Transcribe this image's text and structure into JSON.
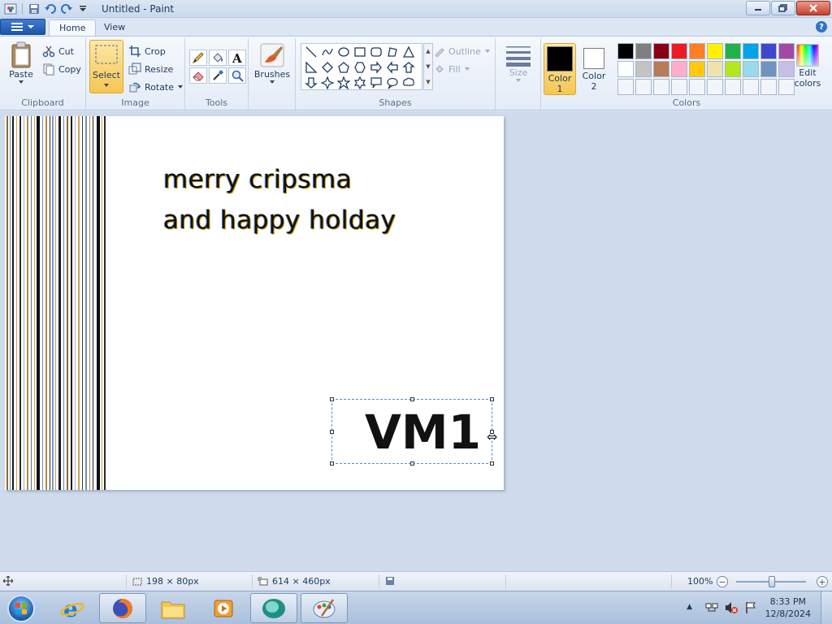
{
  "window": {
    "title": "Untitled - Paint"
  },
  "tabs": [
    {
      "label": "Home"
    },
    {
      "label": "View"
    }
  ],
  "ribbon": {
    "clipboard": {
      "group_label": "Clipboard",
      "paste_label": "Paste",
      "cut_label": "Cut",
      "copy_label": "Copy"
    },
    "image": {
      "group_label": "Image",
      "select_label": "Select",
      "crop_label": "Crop",
      "resize_label": "Resize",
      "rotate_label": "Rotate"
    },
    "tools": {
      "group_label": "Tools"
    },
    "brushes": {
      "label": "Brushes"
    },
    "shapes": {
      "group_label": "Shapes",
      "outline_label": "Outline",
      "fill_label": "Fill"
    },
    "size": {
      "label": "Size"
    },
    "colors": {
      "group_label": "Colors",
      "color1_label": "Color 1",
      "color2_label": "Color 2",
      "edit_label": "Edit colors",
      "color1_value": "#000000",
      "color2_value": "#ffffff",
      "palette_row1": [
        "#000000",
        "#7f7f7f",
        "#880015",
        "#ed1c24",
        "#ff7f27",
        "#fff200",
        "#22b14c",
        "#00a2e8",
        "#3f48cc",
        "#a349a4"
      ],
      "palette_row2": [
        "#ffffff",
        "#c3c3c3",
        "#b97a57",
        "#ffaec9",
        "#ffc90e",
        "#efe4b0",
        "#b5e61d",
        "#99d9ea",
        "#7092be",
        "#c8bfe7"
      ]
    }
  },
  "canvas": {
    "line1": "merry cripsma",
    "line2": "and happy holday",
    "selection_text": "VM1"
  },
  "status": {
    "selection_size": "198 × 80px",
    "canvas_size": "614 × 460px",
    "zoom": "100%"
  },
  "taskbar": {
    "time": "8:33 PM",
    "date": "12/8/2024"
  }
}
